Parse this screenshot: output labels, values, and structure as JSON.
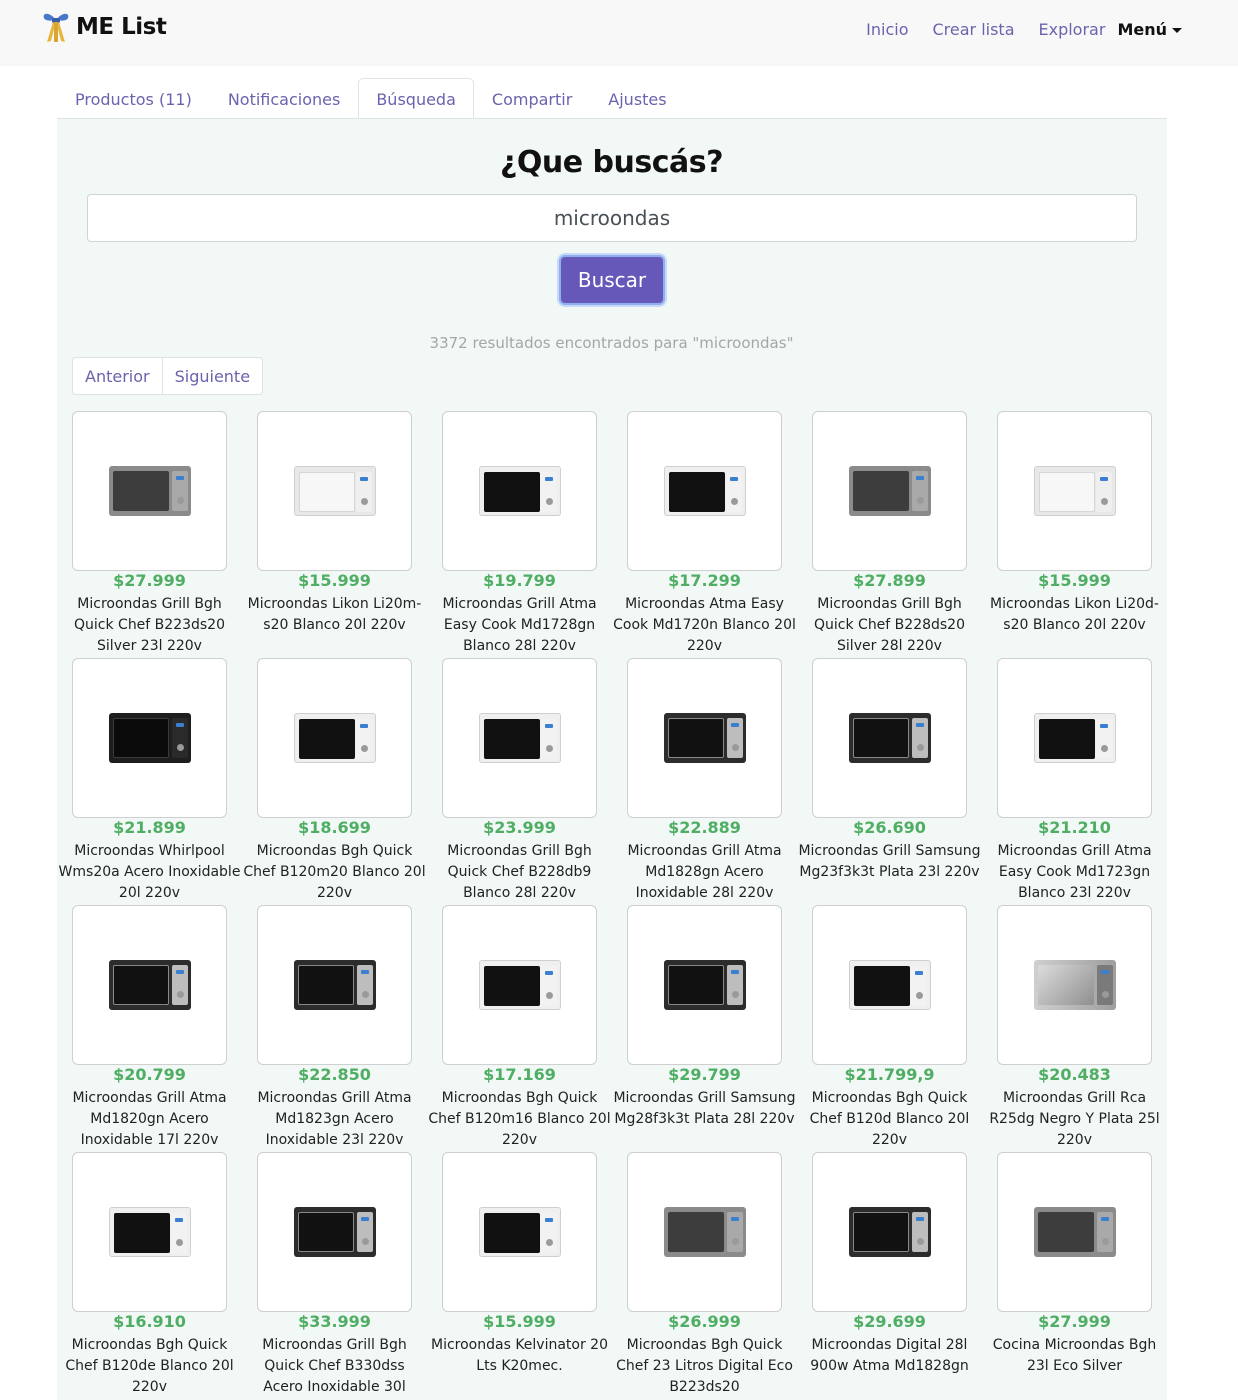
{
  "navbar": {
    "brand": "ME List",
    "links": [
      "Inicio",
      "Crear lista",
      "Explorar"
    ],
    "menu_label": "Menú"
  },
  "tabs": [
    {
      "label": "Productos (11)",
      "active": false
    },
    {
      "label": "Notificaciones",
      "active": false
    },
    {
      "label": "Búsqueda",
      "active": true
    },
    {
      "label": "Compartir",
      "active": false
    },
    {
      "label": "Ajustes",
      "active": false
    }
  ],
  "search": {
    "heading": "¿Que buscás?",
    "value": "microondas",
    "button_label": "Buscar",
    "results_text": "3372 resultados encontrados para \"microondas\""
  },
  "pager": {
    "prev_label": "Anterior",
    "next_label": "Siguiente"
  },
  "products": [
    {
      "price": "$27.999",
      "title": "Microondas Grill Bgh Quick Chef B223ds20 Silver 23l 220v",
      "icon": "microwave-silver"
    },
    {
      "price": "$15.999",
      "title": "Microondas Likon Li20m-s20 Blanco 20l 220v",
      "icon": "microwave-white"
    },
    {
      "price": "$19.799",
      "title": "Microondas Grill Atma Easy Cook Md1728gn Blanco 28l 220v",
      "icon": "microwave-whiteblack"
    },
    {
      "price": "$17.299",
      "title": "Microondas Atma Easy Cook Md1720n Blanco 20l 220v",
      "icon": "microwave-whiteblack"
    },
    {
      "price": "$27.899",
      "title": "Microondas Grill Bgh Quick Chef B228ds20 Silver 28l 220v",
      "icon": "microwave-silver"
    },
    {
      "price": "$15.999",
      "title": "Microondas Likon Li20d-s20 Blanco 20l 220v",
      "icon": "microwave-white"
    },
    {
      "price": "$21.899",
      "title": "Microondas Whirlpool Wms20a Acero Inoxidable 20l 220v",
      "icon": "microwave-black"
    },
    {
      "price": "$18.699",
      "title": "Microondas Bgh Quick Chef B120m20 Blanco 20l 220v",
      "icon": "microwave-whiteblack"
    },
    {
      "price": "$23.999",
      "title": "Microondas Grill Bgh Quick Chef B228db9 Blanco 28l 220v",
      "icon": "microwave-whiteblack"
    },
    {
      "price": "$22.889",
      "title": "Microondas Grill Atma Md1828gn Acero Inoxidable 28l 220v",
      "icon": "microwave-blacksilver"
    },
    {
      "price": "$26.690",
      "title": "Microondas Grill Samsung Mg23f3k3t Plata 23l 220v",
      "icon": "microwave-blacksilver"
    },
    {
      "price": "$21.210",
      "title": "Microondas Grill Atma Easy Cook Md1723gn Blanco 23l 220v",
      "icon": "microwave-whiteblack"
    },
    {
      "price": "$20.799",
      "title": "Microondas Grill Atma Md1820gn Acero Inoxidable 17l 220v",
      "icon": "microwave-blacksilver"
    },
    {
      "price": "$22.850",
      "title": "Microondas Grill Atma Md1823gn Acero Inoxidable 23l 220v",
      "icon": "microwave-blacksilver"
    },
    {
      "price": "$17.169",
      "title": "Microondas Bgh Quick Chef B120m16 Blanco 20l 220v",
      "icon": "microwave-whiteblack"
    },
    {
      "price": "$29.799",
      "title": "Microondas Grill Samsung Mg28f3k3t Plata 28l 220v",
      "icon": "microwave-blacksilver"
    },
    {
      "price": "$21.799,9",
      "title": "Microondas Bgh Quick Chef B120d Blanco 20l 220v",
      "icon": "microwave-whiteblack"
    },
    {
      "price": "$20.483",
      "title": "Microondas Grill Rca R25dg Negro Y Plata 25l 220v",
      "icon": "microwave-steel"
    },
    {
      "price": "$16.910",
      "title": "Microondas Bgh Quick Chef B120de Blanco 20l 220v",
      "icon": "microwave-whiteblack"
    },
    {
      "price": "$33.999",
      "title": "Microondas Grill Bgh Quick Chef B330dss Acero Inoxidable 30l",
      "icon": "microwave-blacksilver"
    },
    {
      "price": "$15.999",
      "title": "Microondas Kelvinator 20 Lts K20mec.",
      "icon": "microwave-whiteblack"
    },
    {
      "price": "$26.999",
      "title": "Microondas Bgh Quick Chef 23 Litros Digital Eco B223ds20",
      "icon": "microwave-silver"
    },
    {
      "price": "$29.699",
      "title": "Microondas Digital 28l 900w Atma Md1828gn",
      "icon": "microwave-blacksilver"
    },
    {
      "price": "$27.999",
      "title": "Cocina Microondas Bgh 23l Eco Silver",
      "icon": "microwave-silver"
    }
  ],
  "colors": {
    "accent": "#6a63ad",
    "button": "#6658b8",
    "price": "#4fae64",
    "panel": "#f1f8f5"
  }
}
